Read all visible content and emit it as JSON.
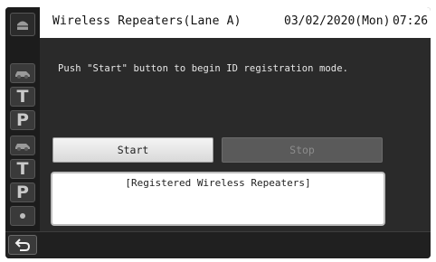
{
  "header": {
    "title": "Wireless Repeaters(Lane A)",
    "date": "03/02/2020(Mon)",
    "time": "07:26"
  },
  "sidebar": {
    "items": [
      {
        "icon": "home-icon"
      },
      {
        "icon": "car-icon"
      },
      {
        "label": "T"
      },
      {
        "label": "P"
      },
      {
        "icon": "car-icon"
      },
      {
        "label": "T"
      },
      {
        "label": "P"
      },
      {
        "icon": "dot-icon"
      }
    ]
  },
  "main": {
    "instruction": "Push \"Start\" button to begin ID registration mode.",
    "start_label": "Start",
    "stop_label": "Stop",
    "list_title": "[Registered Wireless Repeaters]"
  },
  "bottom": {
    "back_icon": "back-arrow-icon"
  }
}
